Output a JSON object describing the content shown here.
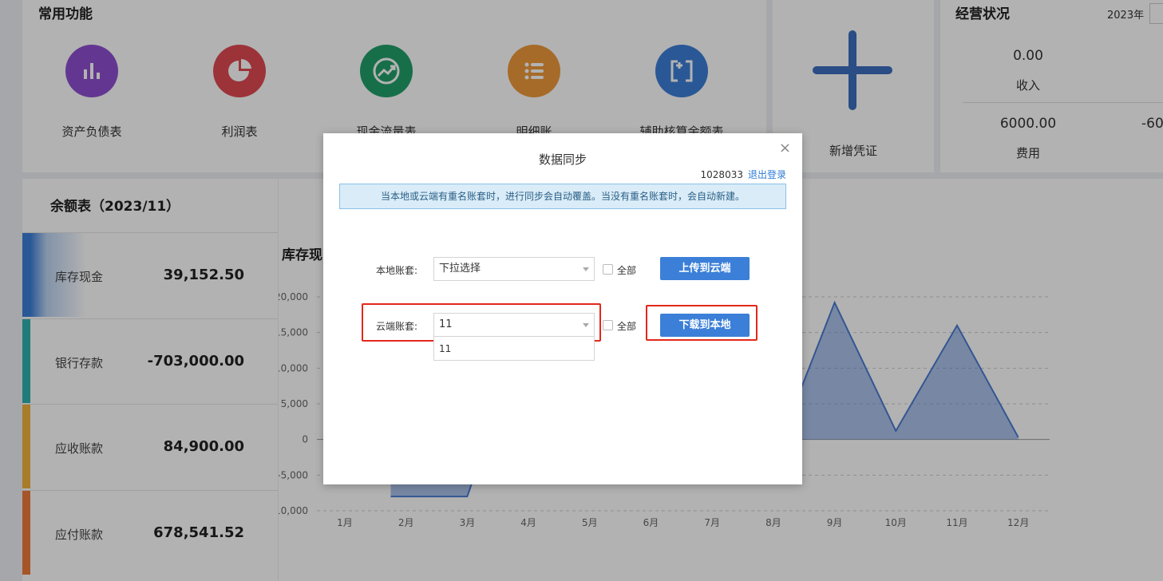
{
  "common": {
    "title": "常用功能",
    "items": [
      {
        "label": "资产负债表",
        "color": "#8f4fd0",
        "icon": "bar-chart-icon"
      },
      {
        "label": "利润表",
        "color": "#e04a52",
        "icon": "pie-chart-icon"
      },
      {
        "label": "现金流量表",
        "color": "#22a06b",
        "icon": "trend-up-icon"
      },
      {
        "label": "明细账",
        "color": "#ee9a3c",
        "icon": "list-icon"
      },
      {
        "label": "辅助核算余额表",
        "color": "#3d7fd7",
        "icon": "bracket-plus-icon"
      }
    ]
  },
  "new_voucher": {
    "label": "新增凭证",
    "color": "#3b6fbd"
  },
  "business": {
    "title": "经营状况",
    "year": "2023年",
    "income_value": "0.00",
    "income_label": "收入",
    "expense_value": "6000.00",
    "expense_label": "费用",
    "expense_value_right": "-60"
  },
  "balance": {
    "title": "余额表（2023/11）",
    "rows": [
      {
        "label": "库存现金",
        "value": "39,152.50",
        "color": "#3b7fd8"
      },
      {
        "label": "银行存款",
        "value": "-703,000.00",
        "color": "#2fb1b1"
      },
      {
        "label": "应收账款",
        "value": "84,900.00",
        "color": "#f1b23b"
      },
      {
        "label": "应付账款",
        "value": "678,541.52",
        "color": "#ee7a3a"
      }
    ]
  },
  "chart_data": {
    "type": "area",
    "title": "库存现",
    "categories": [
      "1月",
      "2月",
      "3月",
      "4月",
      "5月",
      "6月",
      "7月",
      "8月",
      "9月",
      "10月",
      "11月",
      "12月"
    ],
    "yticks": [
      "20,000",
      "15,000",
      "10,000",
      "5,000",
      "0",
      "-5,000",
      "10,000"
    ],
    "ylim": [
      -10000,
      20000
    ],
    "series_color": "#4a7bd2",
    "visible_points": [
      {
        "x": 1.75,
        "y": -8000
      },
      {
        "x": 2,
        "y": -8000
      },
      {
        "x": 3,
        "y": -8000
      },
      {
        "x": 3.1,
        "y": -5500
      },
      {
        "x": 8.4,
        "y": 6000
      },
      {
        "x": 9,
        "y": 19200
      },
      {
        "x": 10,
        "y": 1200
      },
      {
        "x": 11,
        "y": 16000
      },
      {
        "x": 12,
        "y": 300
      }
    ]
  },
  "modal": {
    "title": "数据同步",
    "close": "×",
    "account_id": "1028033",
    "logout": "退出登录",
    "notice": "当本地或云端有重名账套时，进行同步会自动覆盖。当没有重名账套时，会自动新建。",
    "local_label": "本地账套:",
    "local_placeholder": "下拉选择",
    "all_label": "全部",
    "upload_btn": "上传到云端",
    "cloud_label": "云端账套:",
    "cloud_value": "11",
    "cloud_option": "11",
    "download_btn": "下载到本地"
  }
}
